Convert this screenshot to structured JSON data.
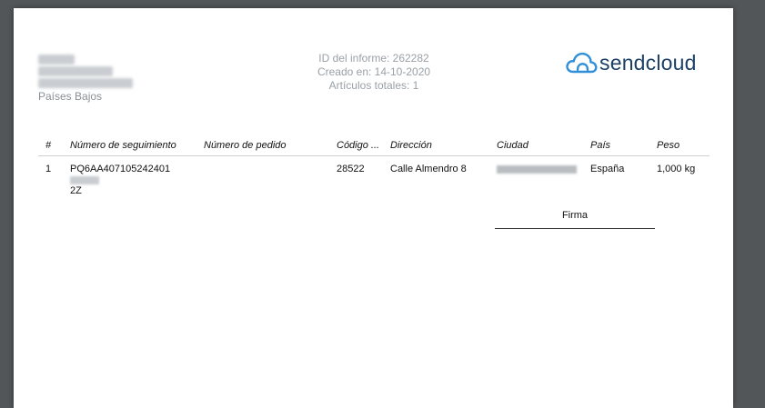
{
  "sender": {
    "country": "Países Bajos"
  },
  "report": {
    "id_line": "ID del informe: 262282",
    "created_line": "Creado en: 14-10-2020",
    "total_line": "Artículos totales: 1"
  },
  "brand": {
    "name": "sendcloud",
    "color": "#1c3f66",
    "icon_color": "#2f8fd8",
    "icon": "cloud-logo-icon"
  },
  "table": {
    "headers": [
      "#",
      "Número de seguimiento",
      "Número de pedido",
      "Código ...",
      "Dirección",
      "Ciudad",
      "País",
      "Peso"
    ],
    "rows": [
      {
        "index": "1",
        "tracking_visible": "PQ6AA407105242401",
        "tracking_tail": "2Z",
        "order": "",
        "postal_code": "28522",
        "address": "Calle Almendro 8",
        "country": "España",
        "weight": "1,000 kg"
      }
    ]
  },
  "signature": {
    "label": "Firma"
  }
}
